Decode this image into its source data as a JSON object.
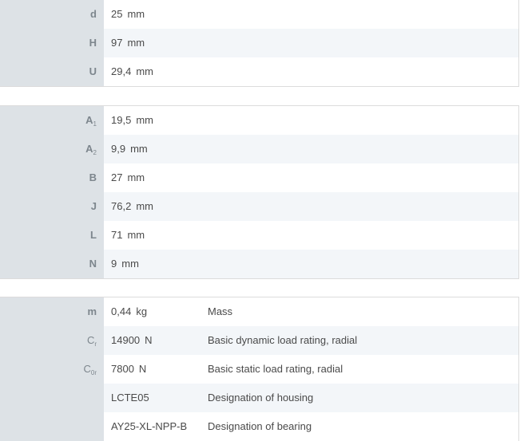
{
  "sections": [
    {
      "rows": [
        {
          "symbol": "d",
          "sub": "",
          "value": "25",
          "unit": "mm",
          "description": ""
        },
        {
          "symbol": "H",
          "sub": "",
          "value": "97",
          "unit": "mm",
          "description": ""
        },
        {
          "symbol": "U",
          "sub": "",
          "value": "29,4",
          "unit": "mm",
          "description": ""
        }
      ]
    },
    {
      "rows": [
        {
          "symbol": "A",
          "sub": "1",
          "value": "19,5",
          "unit": "mm",
          "description": ""
        },
        {
          "symbol": "A",
          "sub": "2",
          "value": "9,9",
          "unit": "mm",
          "description": ""
        },
        {
          "symbol": "B",
          "sub": "",
          "value": "27",
          "unit": "mm",
          "description": ""
        },
        {
          "symbol": "J",
          "sub": "",
          "value": "76,2",
          "unit": "mm",
          "description": ""
        },
        {
          "symbol": "L",
          "sub": "",
          "value": "71",
          "unit": "mm",
          "description": ""
        },
        {
          "symbol": "N",
          "sub": "",
          "value": "9",
          "unit": "mm",
          "description": ""
        }
      ]
    },
    {
      "rows": [
        {
          "symbol": "m",
          "sub": "",
          "value": "0,44",
          "unit": "kg",
          "description": "Mass"
        },
        {
          "symbol": "C",
          "sub": "r",
          "value": "14900",
          "unit": "N",
          "description": "Basic dynamic load rating, radial"
        },
        {
          "symbol": "C",
          "sub": "0r",
          "value": "7800",
          "unit": "N",
          "description": "Basic static load rating, radial"
        },
        {
          "symbol": "",
          "sub": "",
          "value": "LCTE05",
          "unit": "",
          "description": "Designation of housing"
        },
        {
          "symbol": "",
          "sub": "",
          "value": "AY25-XL-NPP-B",
          "unit": "",
          "description": "Designation of bearing"
        }
      ]
    }
  ]
}
